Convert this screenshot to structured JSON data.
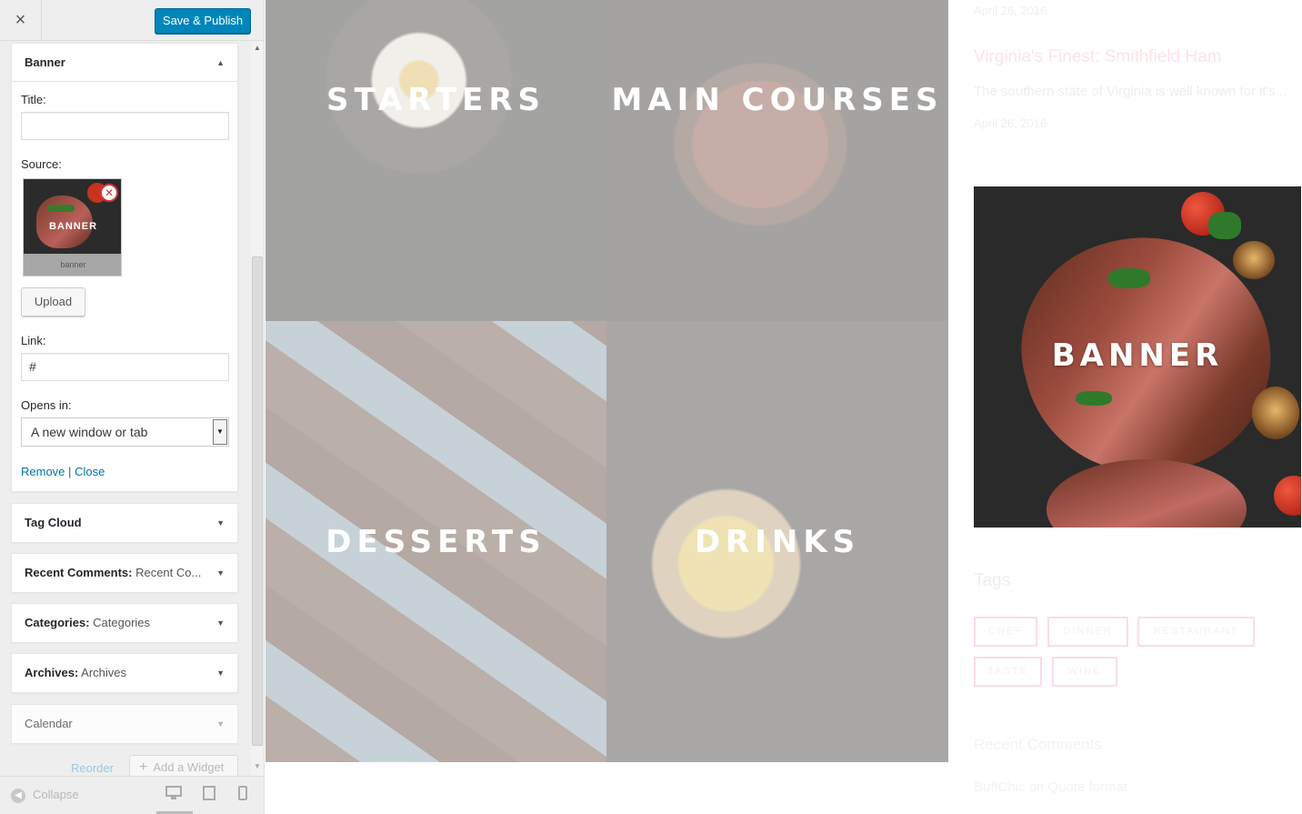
{
  "topbar": {
    "close_icon": "×",
    "save_label": "Save & Publish"
  },
  "banner_widget": {
    "title": "Banner",
    "title_label": "Title:",
    "title_value": "",
    "source_label": "Source:",
    "thumb_word": "BANNER",
    "thumb_caption": "banner",
    "upload_label": "Upload",
    "link_label": "Link:",
    "link_value": "#",
    "opens_label": "Opens in:",
    "opens_value": "A new window or tab",
    "remove_label": "Remove",
    "separator": "|",
    "close_label": "Close"
  },
  "widgets": [
    {
      "title": "Tag Cloud",
      "subtitle": ""
    },
    {
      "title": "Recent Comments:",
      "subtitle": " Recent Co..."
    },
    {
      "title": "Categories:",
      "subtitle": " Categories"
    },
    {
      "title": "Archives:",
      "subtitle": " Archives"
    },
    {
      "title": "Calendar",
      "subtitle": ""
    }
  ],
  "panel_actions": {
    "reorder_label": "Reorder",
    "add_widget_label": "Add a Widget"
  },
  "footer": {
    "collapse_label": "Collapse"
  },
  "preview": {
    "tiles": [
      "STARTERS",
      "MAIN COURSES",
      "DESSERTS",
      "DRINKS"
    ],
    "date_1": "April 26, 2016",
    "post_title": "Virginia's Finest: Smithfield Ham",
    "post_excerpt": "The southern state of Virginia is well known for it's...",
    "date_2": "April 26, 2016",
    "banner_text": "BANNER",
    "tags_heading": "Tags",
    "tags": [
      "CHEF",
      "DINNER",
      "RESTAURANT",
      "TASTE",
      "WINE"
    ],
    "recent_comments_heading": "Recent Comments",
    "recent_comment": "BuffChic on Quote format"
  },
  "colors": {
    "primary_button": "#0085ba",
    "link": "#0073aa",
    "remove_icon": "#d63638"
  }
}
